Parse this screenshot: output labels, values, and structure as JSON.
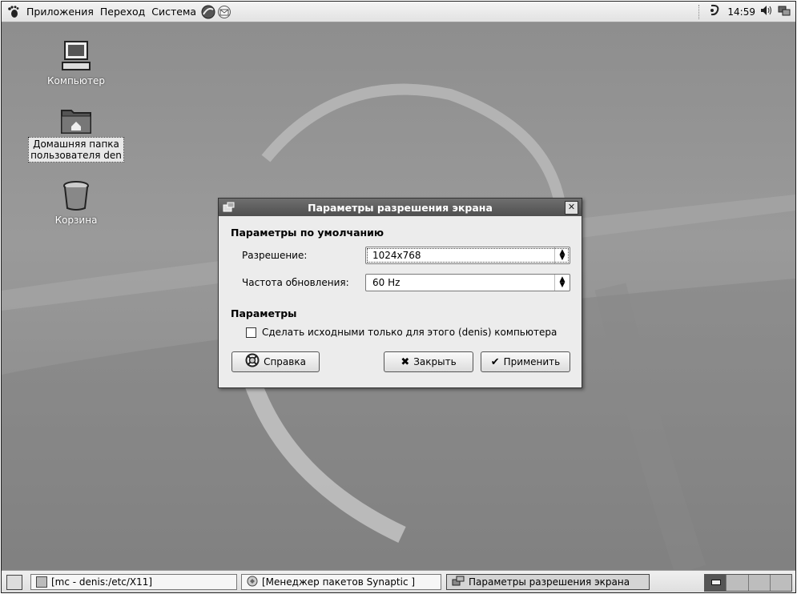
{
  "top_panel": {
    "menu": [
      "Приложения",
      "Переход",
      "Система"
    ],
    "clock": "14:59"
  },
  "desktop": {
    "icons": [
      {
        "label": "Компьютер"
      },
      {
        "label_line1": "Домашняя папка",
        "label_line2": "пользователя den"
      },
      {
        "label": "Корзина"
      }
    ]
  },
  "dialog": {
    "title": "Параметры разрешения экрана",
    "defaults_section": "Параметры по умолчанию",
    "resolution_label": "Разрешение:",
    "resolution_value": "1024x768",
    "refresh_label": "Частота обновления:",
    "refresh_value": "60 Hz",
    "params_section": "Параметры",
    "make_default_label": "Сделать исходными только для этого (denis) компьютера",
    "make_default_checked": false,
    "help_button": "Справка",
    "close_button": "Закрыть",
    "apply_button": "Применить"
  },
  "taskbar": {
    "tasks": [
      {
        "label": "[mc - denis:/etc/X11]"
      },
      {
        "label": "[Менеджер пакетов Synaptic ]"
      },
      {
        "label": "Параметры разрешения экрана"
      }
    ]
  }
}
